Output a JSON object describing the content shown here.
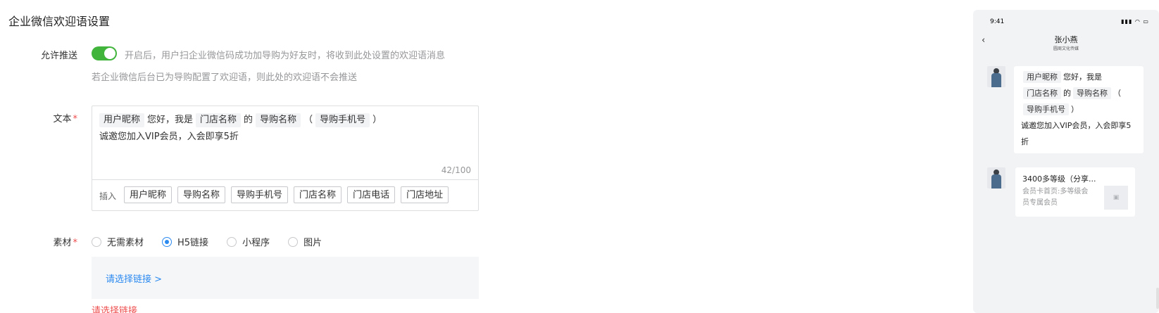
{
  "page": {
    "title": "企业微信欢迎语设置"
  },
  "push": {
    "label": "允许推送",
    "enabled": true,
    "hint_line1": "开启后，用户扫企业微信码成功加导购为好友时，将收到此处设置的欢迎语消息",
    "hint_line2": "若企业微信后台已为导购配置了欢迎语，则此处的欢迎语不会推送"
  },
  "text": {
    "label": "文本",
    "required_mark": "*",
    "content": {
      "chip_nickname": "用户昵称",
      "t1": "您好，我是",
      "chip_store": "门店名称",
      "t2": "的",
      "chip_guide": "导购名称",
      "t3": "（",
      "chip_phone": "导购手机号",
      "t4": "）",
      "line2": "诚邀您加入VIP会员，入会即享5折"
    },
    "counter": "42/100",
    "insert_label": "插入",
    "insert_buttons": [
      "用户昵称",
      "导购名称",
      "导购手机号",
      "门店名称",
      "门店电话",
      "门店地址"
    ]
  },
  "material": {
    "label": "素材",
    "required_mark": "*",
    "options": [
      "无需素材",
      "H5链接",
      "小程序",
      "图片"
    ],
    "selected": "H5链接",
    "link_prompt": "请选择链接 >",
    "error": "请选择链接"
  },
  "preview": {
    "time": "9:41",
    "status_icons": "▮▮▮ ◠ ▭",
    "back_icon": "‹",
    "name": "张小燕",
    "company": "圆周文化传媒",
    "message": {
      "chip_nickname": "用户昵称",
      "t1": "您好，我是",
      "chip_store": "门店名称",
      "t2": "的",
      "chip_guide": "导购名称",
      "t3": "（",
      "chip_phone": "导购手机号",
      "t4": "）",
      "line2": "诚邀您加入VIP会员，入会即享5折"
    },
    "card": {
      "title": "3400多等级（分享...",
      "desc": "会员卡首页:多等级会员专属会员",
      "thumb_icon": "image-icon"
    }
  },
  "colors": {
    "accent": "#2b8af0",
    "switch_on": "#41b43c",
    "error": "#ee4c4c"
  }
}
